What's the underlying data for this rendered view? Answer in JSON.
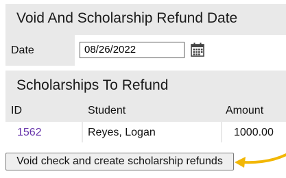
{
  "void_section": {
    "title": "Void And Scholarship Refund Date",
    "date_label": "Date",
    "date_value": "08/26/2022",
    "calendar_icon": "calendar-icon"
  },
  "refund_section": {
    "title": "Scholarships To Refund",
    "columns": [
      "ID",
      "Student",
      "Amount"
    ],
    "rows": [
      {
        "id": "1562",
        "student": "Reyes, Logan",
        "amount": "1000.00"
      }
    ]
  },
  "action_button": "Void check and create scholarship refunds",
  "annotation_icon": "arrow-pointer-icon",
  "colors": {
    "panel": "#e9e9e9",
    "link": "#6633aa",
    "arrow": "#f2b705"
  }
}
